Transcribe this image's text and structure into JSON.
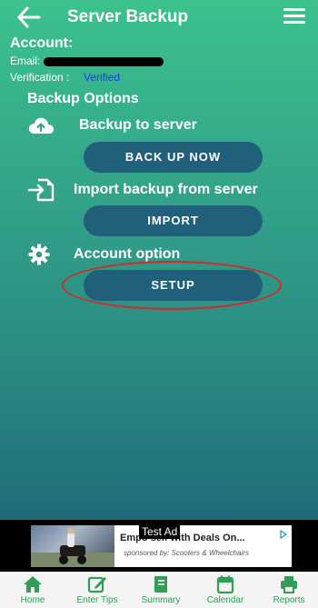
{
  "header": {
    "title": "Server Backup"
  },
  "account": {
    "label": "Account:",
    "email_label": "Email:",
    "verification_label": "Verification :",
    "verification_value": "Verified"
  },
  "backup": {
    "section_title": "Backup Options",
    "options": [
      {
        "label": "Backup to server",
        "button": "BACK UP NOW",
        "icon": "cloud-upload-icon"
      },
      {
        "label": "Import backup from server",
        "button": "IMPORT",
        "icon": "import-icon"
      },
      {
        "label": "Account option",
        "button": "SETUP",
        "icon": "gear-icon"
      }
    ]
  },
  "ad": {
    "badge": "Test Ad",
    "headline": "Empo        self with Deals On...",
    "sponsor": "sponsored by: Scooters & Wheelchairs"
  },
  "nav": {
    "items": [
      {
        "label": "Home",
        "icon": "home-icon"
      },
      {
        "label": "Enter Tips",
        "icon": "edit-icon"
      },
      {
        "label": "Summary",
        "icon": "book-icon"
      },
      {
        "label": "Calendar",
        "icon": "calendar-icon"
      },
      {
        "label": "Reports",
        "icon": "printer-icon"
      }
    ]
  },
  "colors": {
    "gradient_top": "#3cc28d",
    "gradient_bottom": "#1f6b79",
    "button_fill": "#20607a",
    "verified_text": "#1c3ce6",
    "nav_accent": "#2f9f57",
    "highlight_ring": "#d22a2a"
  }
}
